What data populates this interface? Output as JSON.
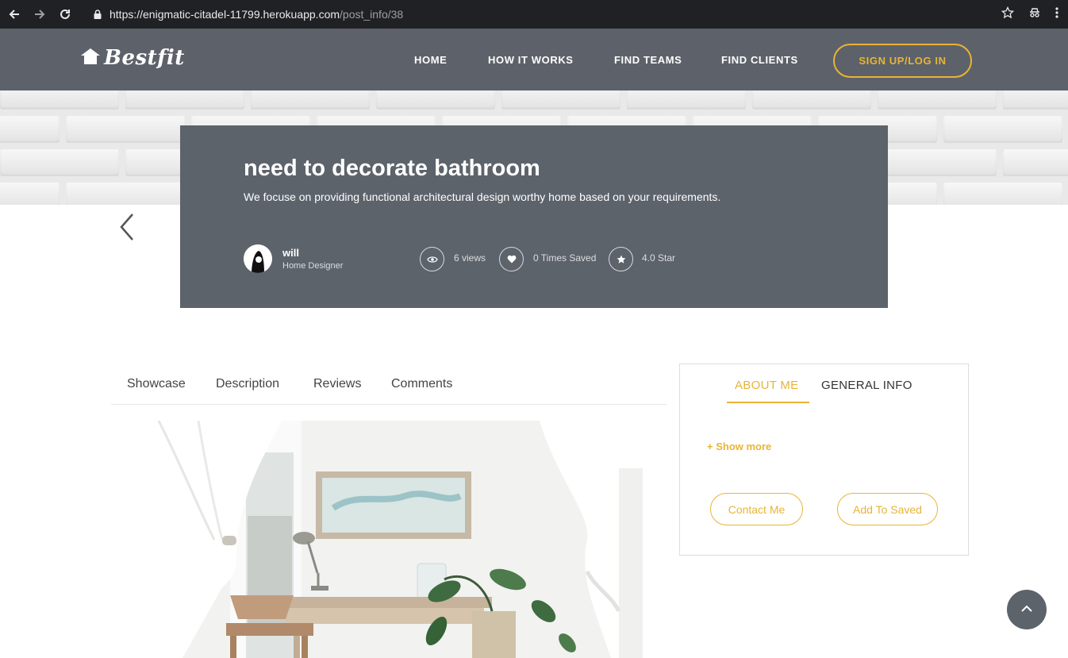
{
  "browser": {
    "url_host": "https://enigmatic-citadel-11799.herokuapp.com",
    "url_path": "/post_info/38"
  },
  "header": {
    "logo": "Bestfit",
    "nav": [
      "HOME",
      "HOW IT WORKS",
      "FIND TEAMS",
      "FIND CLIENTS"
    ],
    "signup": "SIGN UP/LOG IN"
  },
  "post": {
    "title": "need to decorate bathroom",
    "subtitle": "We focuse on providing functional architectural design worthy home based on your requirements.",
    "author": {
      "name": "will",
      "role": "Home Designer"
    },
    "stats": {
      "views": "6 views",
      "saved": "0 Times Saved",
      "rating": "4.0 Star"
    }
  },
  "tabs": [
    "Showcase",
    "Description",
    "Reviews",
    "Comments"
  ],
  "sidebar": {
    "tabs": [
      "ABOUT ME",
      "GENERAL INFO"
    ],
    "active_tab": "ABOUT ME",
    "show_more": "+ Show more",
    "contact_button": "Contact Me",
    "save_button": "Add To Saved"
  },
  "colors": {
    "accent": "#e8b436",
    "header_bg": "#5d626a",
    "card_bg": "#5d636b"
  }
}
